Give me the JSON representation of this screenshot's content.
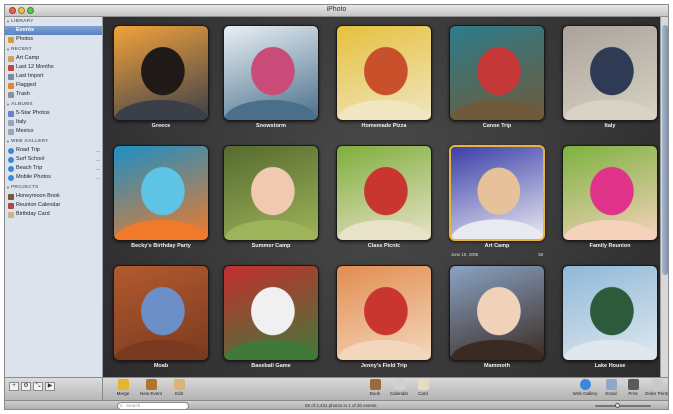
{
  "window": {
    "title": "iPhoto"
  },
  "sidebar": {
    "library": {
      "header": "LIBRARY",
      "items": [
        {
          "label": "Events",
          "icon": "events-icon",
          "selected": true
        },
        {
          "label": "Photos",
          "icon": "photos-icon",
          "selected": false
        }
      ]
    },
    "recent": {
      "header": "RECENT",
      "items": [
        {
          "label": "Art Camp",
          "icon": "event-icon"
        },
        {
          "label": "Last 12 Months",
          "icon": "calendar-icon"
        },
        {
          "label": "Last Import",
          "icon": "import-icon"
        },
        {
          "label": "Flagged",
          "icon": "flag-icon"
        },
        {
          "label": "Trash",
          "icon": "trash-icon"
        }
      ]
    },
    "albums": {
      "header": "ALBUMS",
      "items": [
        {
          "label": "5-Star Photos",
          "icon": "smart-album-icon"
        },
        {
          "label": "Italy",
          "icon": "album-icon"
        },
        {
          "label": "Mexico",
          "icon": "album-icon"
        }
      ]
    },
    "web_gallery": {
      "header": "WEB GALLERY",
      "items": [
        {
          "label": "Road Trip",
          "icon": "globe-icon"
        },
        {
          "label": "Surf School",
          "icon": "globe-icon"
        },
        {
          "label": "Beach Trip",
          "icon": "globe-icon"
        },
        {
          "label": "Mobile Photos",
          "icon": "globe-icon"
        }
      ]
    },
    "projects": {
      "header": "PROJECTS",
      "items": [
        {
          "label": "Honeymoon Book",
          "icon": "book-icon"
        },
        {
          "label": "Reunion Calendar",
          "icon": "calendar-project-icon"
        },
        {
          "label": "Birthday Card",
          "icon": "card-icon"
        }
      ]
    }
  },
  "events": [
    {
      "label": "Greece",
      "colors": [
        "#f2a23a",
        "#1f1a17",
        "#3b3f4a"
      ]
    },
    {
      "label": "Snowstorm",
      "colors": [
        "#e9f0f6",
        "#c94b78",
        "#4a6f8a"
      ]
    },
    {
      "label": "Homemade Pizza",
      "colors": [
        "#e6c03d",
        "#c8502a",
        "#f0e6c0"
      ]
    },
    {
      "label": "Canoe Trip",
      "colors": [
        "#2d7c8a",
        "#c43838",
        "#6f5a3a"
      ]
    },
    {
      "label": "Italy",
      "colors": [
        "#a9a39a",
        "#2f3a55",
        "#d9d2c5"
      ]
    },
    {
      "label": "Becky's Birthday Party",
      "colors": [
        "#1d8fc4",
        "#5ec4e6",
        "#f07a2a"
      ]
    },
    {
      "label": "Summer Camp",
      "colors": [
        "#556b2f",
        "#f1c8b0",
        "#9fb35a"
      ]
    },
    {
      "label": "Class Picnic",
      "colors": [
        "#7fae3c",
        "#c8362f",
        "#e8e2c8"
      ]
    },
    {
      "label": "Art Camp",
      "colors": [
        "#3a3fa8",
        "#e7c19a",
        "#e9e9f2"
      ],
      "selected": true,
      "date": "June 15, 2006",
      "count": "58"
    },
    {
      "label": "Family Reunion",
      "colors": [
        "#7cb23f",
        "#e0338a",
        "#f5d2bb"
      ]
    },
    {
      "label": "Moab",
      "colors": [
        "#b25a2e",
        "#6c8fc7",
        "#7a3a20"
      ]
    },
    {
      "label": "Baseball Game",
      "colors": [
        "#c42f2f",
        "#f0f0f0",
        "#3f7a3a"
      ]
    },
    {
      "label": "Jenny's Field Trip",
      "colors": [
        "#e28d4f",
        "#c8362f",
        "#f3d7bd"
      ]
    },
    {
      "label": "Mammoth",
      "colors": [
        "#8aa3c4",
        "#f0d2bb",
        "#3a2a22"
      ]
    },
    {
      "label": "Lake House",
      "colors": [
        "#8fb8d8",
        "#2d5a3a",
        "#dfe8ee"
      ]
    }
  ],
  "toolbar": {
    "left": [
      {
        "label": "Merge",
        "icon": "merge-icon"
      },
      {
        "label": "New Event",
        "icon": "new-event-icon"
      },
      {
        "label": "Edit",
        "icon": "edit-icon"
      }
    ],
    "center": [
      {
        "label": "Book",
        "icon": "book-icon"
      },
      {
        "label": "Calendar",
        "icon": "calendar-icon"
      },
      {
        "label": "Card",
        "icon": "card-icon"
      }
    ],
    "right": [
      {
        "label": "Web Gallery",
        "icon": "web-gallery-icon"
      },
      {
        "label": "Email",
        "icon": "email-icon"
      },
      {
        "label": "Print",
        "icon": "print-icon"
      },
      {
        "label": "Order Prints",
        "icon": "order-prints-icon"
      }
    ]
  },
  "search": {
    "placeholder": "Search"
  },
  "status": {
    "text": "58 of 2,431 photos in 1 of 30 events"
  },
  "zoom": {
    "level": 0.4
  },
  "sidebar_controls": [
    "+",
    "⚙",
    "⤡",
    "▶"
  ]
}
